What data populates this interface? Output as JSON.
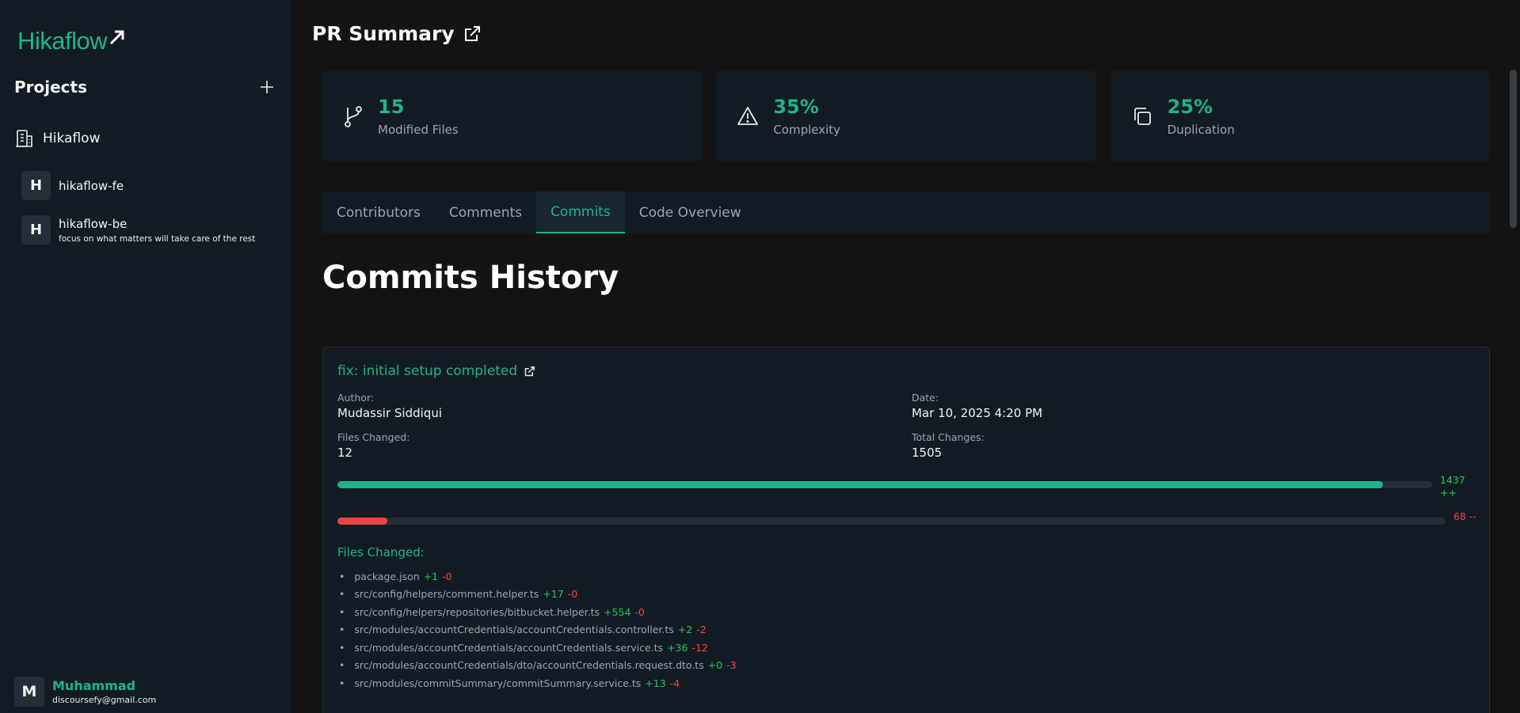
{
  "sidebar": {
    "logo_text": "Hikaflow",
    "projects_title": "Projects",
    "workspace": {
      "name": "Hikaflow"
    },
    "repos": [
      {
        "avatar": "H",
        "name": "hikaflow-fe",
        "desc": ""
      },
      {
        "avatar": "H",
        "name": "hikaflow-be",
        "desc": "focus on what matters will take care of the rest"
      }
    ],
    "user": {
      "avatar": "M",
      "name": "Muhammad",
      "email": "discoursefy@gmail.com"
    }
  },
  "main": {
    "title": "PR Summary",
    "stats": [
      {
        "value": "15",
        "label": "Modified Files",
        "icon": "git-branch-icon"
      },
      {
        "value": "35%",
        "label": "Complexity",
        "icon": "warning-icon"
      },
      {
        "value": "25%",
        "label": "Duplication",
        "icon": "copy-icon"
      }
    ],
    "tabs": [
      "Contributors",
      "Comments",
      "Commits",
      "Code Overview"
    ],
    "active_tab": "Commits",
    "section_title": "Commits History",
    "commit": {
      "title": "fix: initial setup completed",
      "author_label": "Author:",
      "author": "Mudassir Siddiqui",
      "date_label": "Date:",
      "date": "Mar 10, 2025 4:20 PM",
      "files_changed_label": "Files Changed:",
      "files_changed": "12",
      "total_changes_label": "Total Changes:",
      "total_changes": "1505",
      "additions_label": "1437 ++",
      "deletions_label": "68 --",
      "additions_fraction": 0.955,
      "deletions_fraction": 0.045,
      "files_title": "Files Changed:",
      "files": [
        {
          "path": "package.json",
          "add": "+1",
          "del": "-0"
        },
        {
          "path": "src/config/helpers/comment.helper.ts",
          "add": "+17",
          "del": "-0"
        },
        {
          "path": "src/config/helpers/repositories/bitbucket.helper.ts",
          "add": "+554",
          "del": "-0"
        },
        {
          "path": "src/modules/accountCredentials/accountCredentials.controller.ts",
          "add": "+2",
          "del": "-2"
        },
        {
          "path": "src/modules/accountCredentials/accountCredentials.service.ts",
          "add": "+36",
          "del": "-12"
        },
        {
          "path": "src/modules/accountCredentials/dto/accountCredentials.request.dto.ts",
          "add": "+0",
          "del": "-3"
        },
        {
          "path": "src/modules/commitSummary/commitSummary.service.ts",
          "add": "+13",
          "del": "-4"
        }
      ]
    }
  },
  "colors": {
    "accent": "#1eb38a",
    "addition": "#22c55e",
    "deletion": "#ef4444",
    "sidebar_bg": "#131c24",
    "page_bg": "#141414"
  }
}
